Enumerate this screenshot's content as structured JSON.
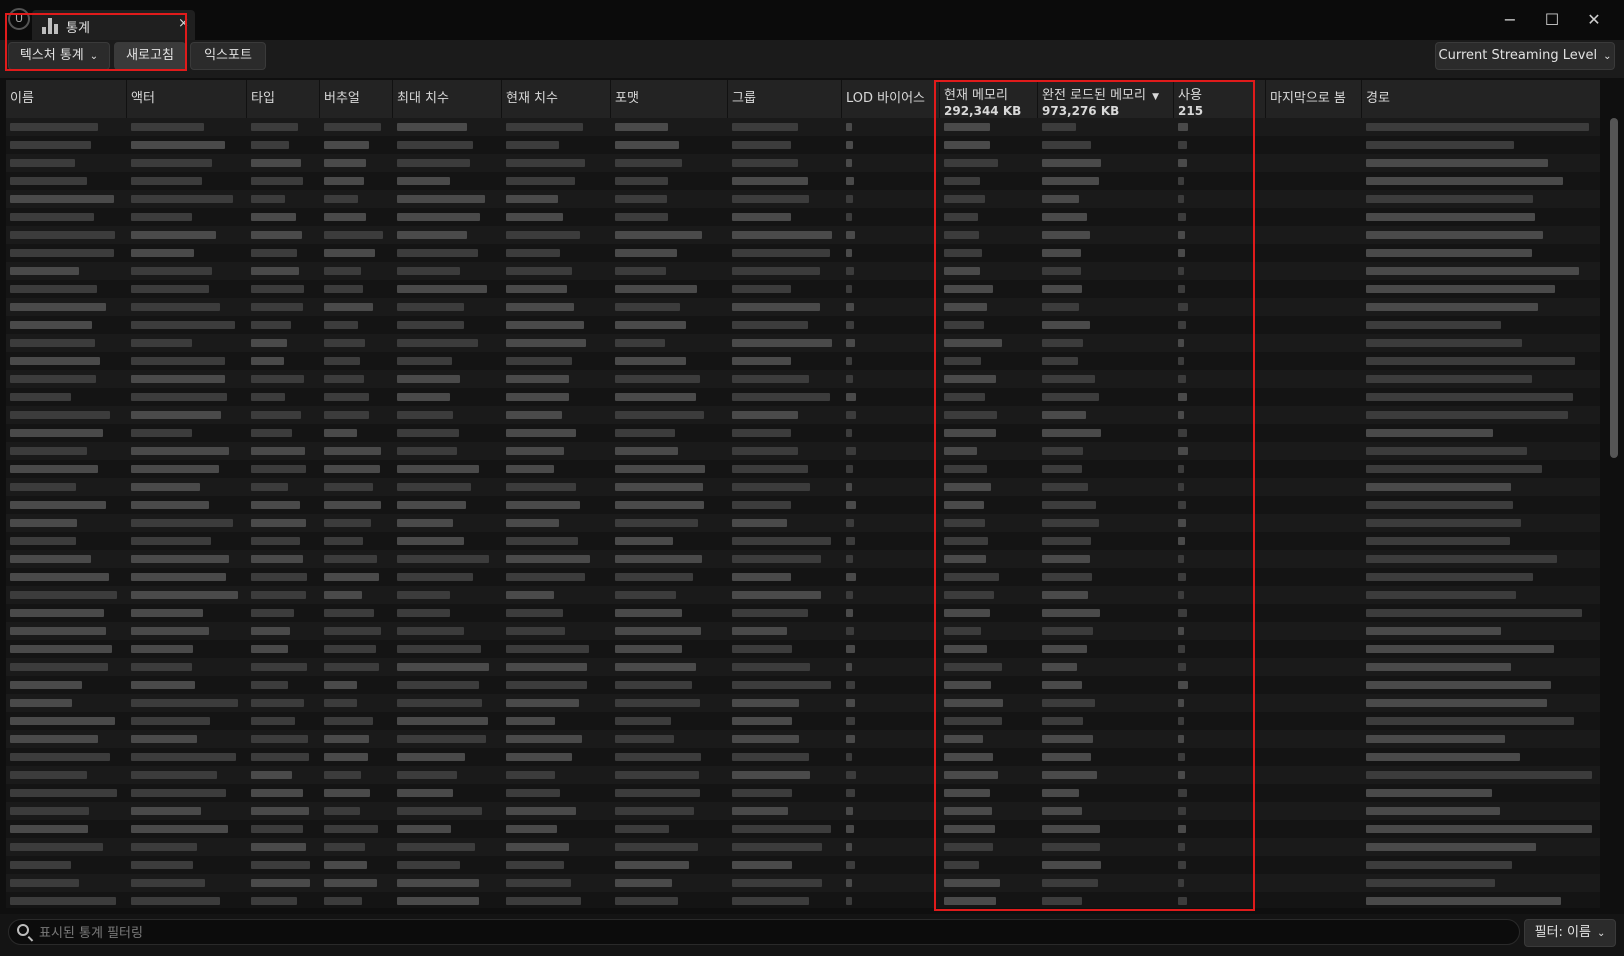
{
  "window": {
    "tab_title": "통계",
    "tab_close": "×",
    "minimize": "−",
    "maximize": "☐",
    "close": "✕"
  },
  "toolbar": {
    "stats_dropdown": "텍스처 통계",
    "refresh": "새로고침",
    "export": "익스포트",
    "level_dropdown": "Current Streaming Level"
  },
  "table": {
    "columns": [
      {
        "label": "이름"
      },
      {
        "label": "액터"
      },
      {
        "label": "타입"
      },
      {
        "label": "버추얼"
      },
      {
        "label": "최대 치수"
      },
      {
        "label": "현재 치수"
      },
      {
        "label": "포맷"
      },
      {
        "label": "그룹"
      },
      {
        "label": "LOD 바이어스"
      },
      {
        "label": "현재 메모리",
        "summary": "292,344 KB"
      },
      {
        "label": "완전 로드된 메모리",
        "summary": "973,276 KB",
        "sorted": "descending"
      },
      {
        "label": "사용",
        "summary": "215"
      },
      {
        "label": "마지막으로 봄"
      },
      {
        "label": "경로"
      }
    ],
    "rows_blurred": true
  },
  "footer": {
    "filter_placeholder": "표시된 통계 필터링",
    "filter_button": "필터: 이름"
  },
  "colors": {
    "highlight": "#e01b1b",
    "background": "#151515",
    "header": "#232323"
  }
}
